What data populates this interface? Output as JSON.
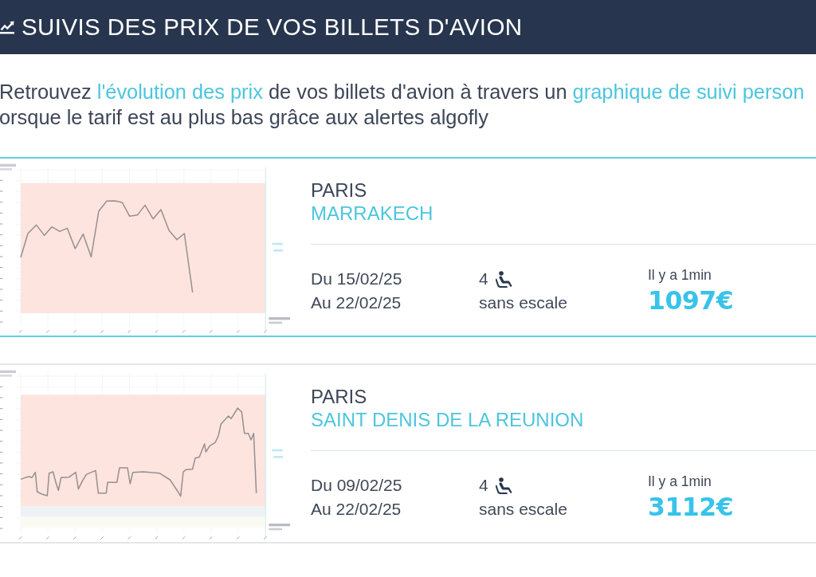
{
  "header": {
    "title": "SUIVIS DES PRIX DE VOS BILLETS D'AVION"
  },
  "intro": {
    "lines": [
      [
        {
          "kind": "text",
          "text": "Retrouvez "
        },
        {
          "kind": "link",
          "text": "l'évolution des prix"
        },
        {
          "kind": "text",
          "text": " de vos billets d'avion à travers un "
        },
        {
          "kind": "link",
          "text": "graphique de suivi person"
        }
      ],
      [
        {
          "kind": "text",
          "text": "orsque le tarif est au plus bas grâce aux alertes algofly"
        }
      ]
    ]
  },
  "cards": [
    {
      "selected": true,
      "origin": "PARIS",
      "destination": "MARRAKECH",
      "depart": "Du 15/02/25",
      "return": "Au 22/02/25",
      "passengers": "4",
      "stops": "sans escale",
      "updated": "Il y a 1min",
      "price": "1097€"
    },
    {
      "selected": false,
      "origin": "PARIS",
      "destination": "SAINT DENIS DE LA REUNION",
      "depart": "Du 09/02/25",
      "return": "Au 22/02/25",
      "passengers": "4",
      "stops": "sans escale",
      "updated": "Il y a 1min",
      "price": "3112€"
    }
  ]
}
